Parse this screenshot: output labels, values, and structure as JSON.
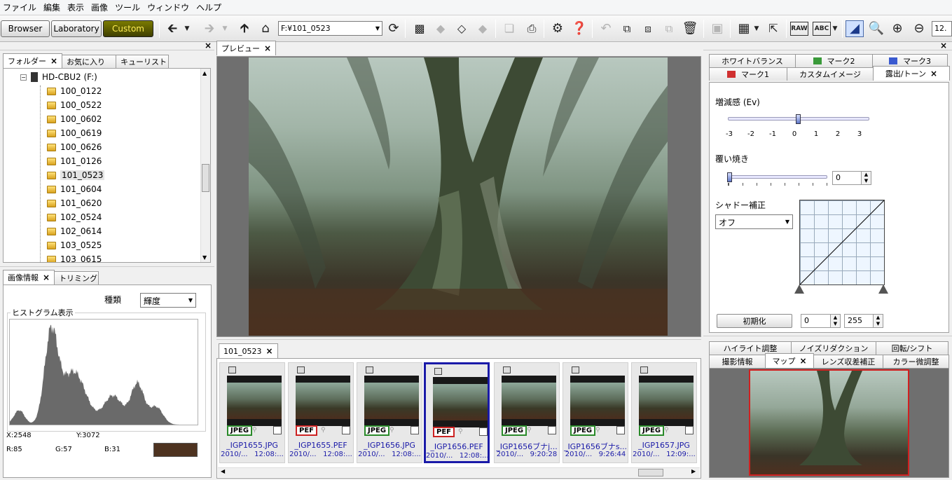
{
  "menu": [
    "ファイル",
    "編集",
    "表示",
    "画像",
    "ツール",
    "ウィンドウ",
    "ヘルプ"
  ],
  "modes": {
    "browser": "Browser",
    "laboratory": "Laboratory",
    "custom": "Custom"
  },
  "toolbar": {
    "path": "F:¥101_0523",
    "zoom": "12."
  },
  "left_tabs": {
    "folder": "フォルダー",
    "favorites": "お気に入り",
    "queue": "キューリスト"
  },
  "tree": {
    "drive": "HD-CBU2 (F:)",
    "folders": [
      "100_0122",
      "100_0522",
      "100_0602",
      "100_0619",
      "100_0626",
      "101_0126",
      "101_0523",
      "101_0604",
      "101_0620",
      "102_0524",
      "102_0614",
      "103_0525",
      "103_0615"
    ]
  },
  "info_tabs": {
    "info": "画像情報",
    "trim": "トリミング"
  },
  "histogram": {
    "kind_label": "種類",
    "kind_value": "輝度",
    "group_label": "ヒストグラム表示",
    "x": "X:2548",
    "y": "Y:3072",
    "r": "R:85",
    "g": "G:57",
    "b": "B:31",
    "swatch": "#4e3320"
  },
  "preview": {
    "tab": "プレビュー"
  },
  "strip": {
    "tab": "101_0523",
    "items": [
      {
        "type": "JPEG",
        "name": "_IGP1655.JPG",
        "date": "2010/...",
        "time": "12:08:..."
      },
      {
        "type": "PEF",
        "name": "_IGP1655.PEF",
        "date": "2010/...",
        "time": "12:08:..."
      },
      {
        "type": "JPEG",
        "name": "_IGP1656.JPG",
        "date": "2010/...",
        "time": "12:08:..."
      },
      {
        "type": "PEF",
        "name": "_IGP1656.PEF",
        "date": "2010/...",
        "time": "12:08:..."
      },
      {
        "type": "JPEG",
        "name": "_IGP1656ブナj...",
        "date": "2010/...",
        "time": "9:20:28"
      },
      {
        "type": "JPEG",
        "name": "_IGP1656ブナs...",
        "date": "2010/...",
        "time": "9:26:44"
      },
      {
        "type": "JPEG",
        "name": "_IGP1657.JPG",
        "date": "2010/...",
        "time": "12:09:..."
      }
    ],
    "selected_index": 3
  },
  "right_tabs": {
    "wb": "ホワイトバランス",
    "mark2": "マーク2",
    "mark3": "マーク3",
    "mark1": "マーク1",
    "custom": "カスタムイメージ",
    "exposure": "露出/トーン"
  },
  "exposure": {
    "ev_label": "増減感 (Ev)",
    "ev_ticks": [
      "-3",
      "-2",
      "-1",
      "0",
      "1",
      "2",
      "3"
    ],
    "ev_value": 0,
    "burn_label": "覆い焼き",
    "burn_value": "0",
    "shadow_label": "シャドー補正",
    "shadow_value": "オフ",
    "reset_label": "初期化",
    "low_value": "0",
    "high_value": "255"
  },
  "bottom_right_tabs": {
    "highlight": "ハイライト調整",
    "noise": "ノイズリダクション",
    "rotate": "回転/シフト",
    "shoot": "撮影情報",
    "map": "マップ",
    "lens": "レンズ収差補正",
    "color": "カラー微調整"
  }
}
